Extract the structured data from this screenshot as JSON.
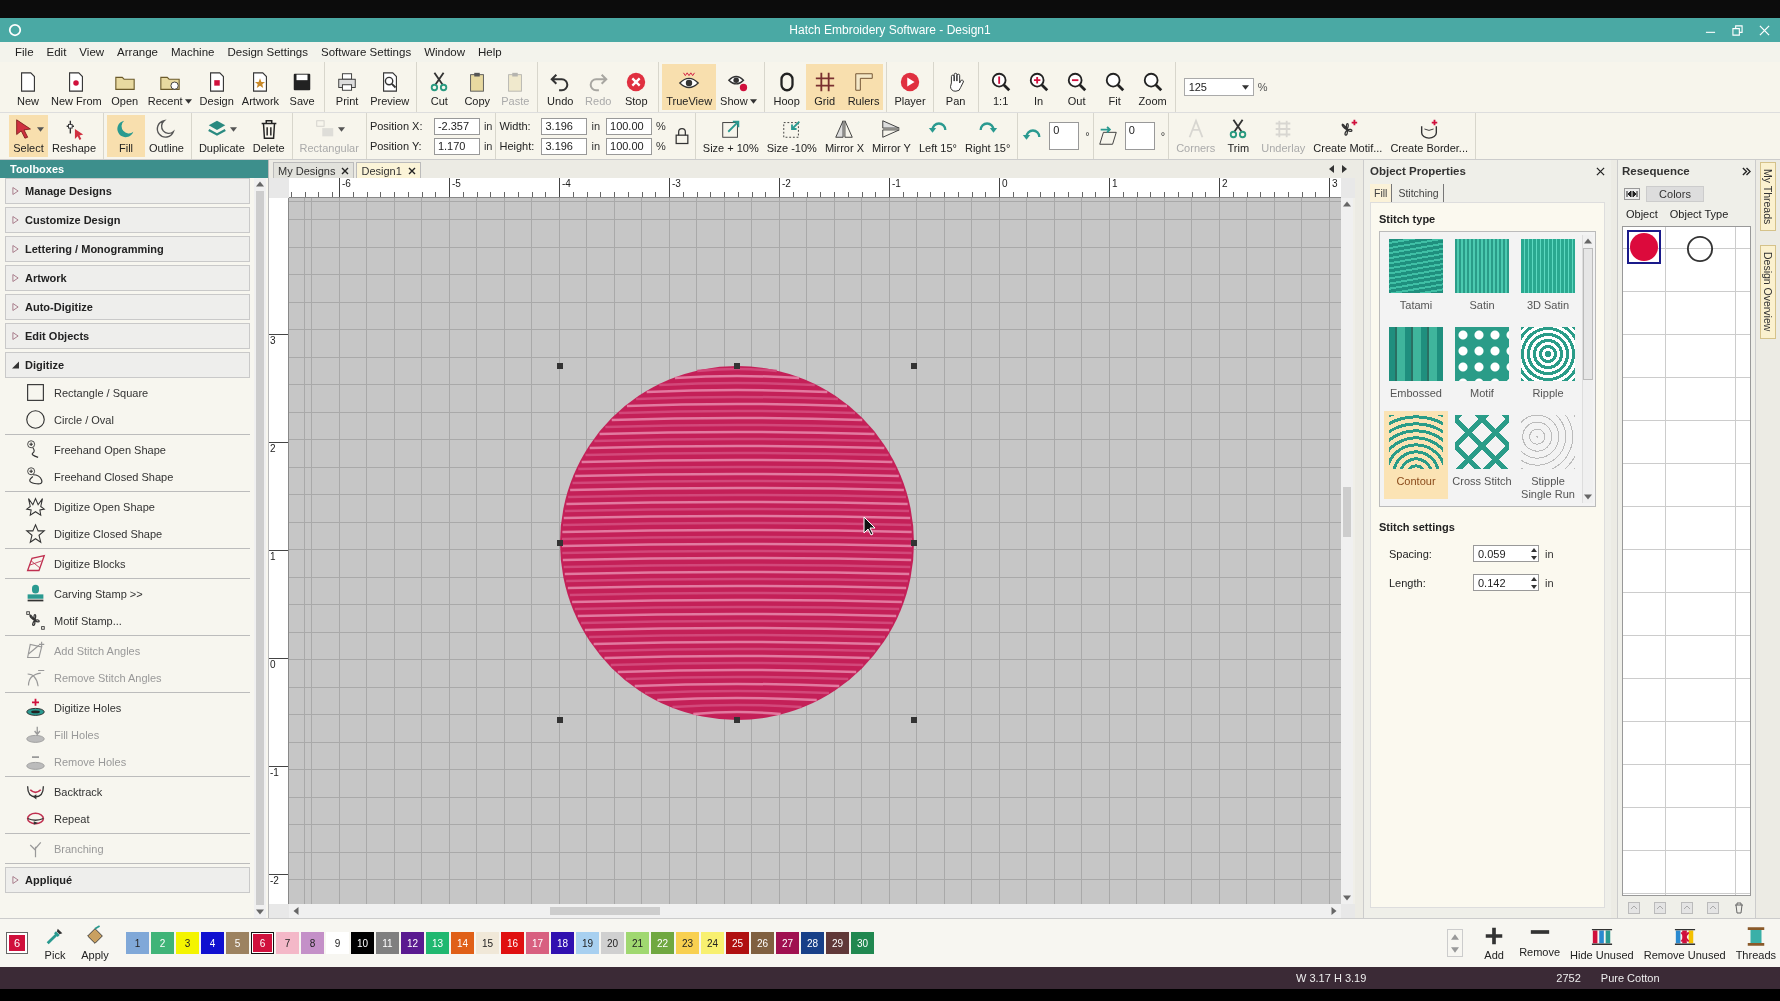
{
  "window": {
    "title": "Hatch Embroidery Software - Design1"
  },
  "menu": [
    "File",
    "Edit",
    "View",
    "Arrange",
    "Machine",
    "Design Settings",
    "Software Settings",
    "Window",
    "Help"
  ],
  "toolbar": {
    "groups": [
      [
        {
          "label": "New",
          "selected": false,
          "disabled": false,
          "caret": false
        },
        {
          "label": "New From",
          "selected": false,
          "disabled": false,
          "caret": false
        },
        {
          "label": "Open",
          "selected": false,
          "disabled": false,
          "caret": false
        },
        {
          "label": "Recent",
          "selected": false,
          "disabled": false,
          "caret": true
        },
        {
          "label": "Design",
          "selected": false,
          "disabled": false,
          "caret": false
        },
        {
          "label": "Artwork",
          "selected": false,
          "disabled": false,
          "caret": false
        },
        {
          "label": "Save",
          "selected": false,
          "disabled": false,
          "caret": false
        }
      ],
      [
        {
          "label": "Print",
          "selected": false,
          "disabled": false,
          "caret": false
        },
        {
          "label": "Preview",
          "selected": false,
          "disabled": false,
          "caret": false
        }
      ],
      [
        {
          "label": "Cut",
          "selected": false,
          "disabled": false,
          "caret": false
        },
        {
          "label": "Copy",
          "selected": false,
          "disabled": false,
          "caret": false
        },
        {
          "label": "Paste",
          "selected": false,
          "disabled": true,
          "caret": false
        }
      ],
      [
        {
          "label": "Undo",
          "selected": false,
          "disabled": false,
          "caret": false
        },
        {
          "label": "Redo",
          "selected": false,
          "disabled": true,
          "caret": false
        },
        {
          "label": "Stop",
          "selected": false,
          "disabled": false,
          "caret": false
        }
      ],
      [
        {
          "label": "TrueView",
          "selected": true,
          "disabled": false,
          "caret": false
        },
        {
          "label": "Show",
          "selected": false,
          "disabled": false,
          "caret": true
        }
      ],
      [
        {
          "label": "Hoop",
          "selected": false,
          "disabled": false,
          "caret": false
        },
        {
          "label": "Grid",
          "selected": true,
          "disabled": false,
          "caret": false
        },
        {
          "label": "Rulers",
          "selected": true,
          "disabled": false,
          "caret": false
        }
      ],
      [
        {
          "label": "Player",
          "selected": false,
          "disabled": false,
          "caret": false
        }
      ],
      [
        {
          "label": "Pan",
          "selected": false,
          "disabled": false,
          "caret": false
        }
      ],
      [
        {
          "label": "1:1",
          "selected": false,
          "disabled": false,
          "caret": false
        },
        {
          "label": "In",
          "selected": false,
          "disabled": false,
          "caret": false
        },
        {
          "label": "Out",
          "selected": false,
          "disabled": false,
          "caret": false
        },
        {
          "label": "Fit",
          "selected": false,
          "disabled": false,
          "caret": false
        },
        {
          "label": "Zoom",
          "selected": false,
          "disabled": false,
          "caret": false
        }
      ]
    ],
    "zoom": {
      "value": "125",
      "unit": "%"
    }
  },
  "edit_bar": {
    "left_groups": [
      [
        {
          "label": "Select",
          "selected": true,
          "disabled": false,
          "caret": true
        },
        {
          "label": "Reshape",
          "selected": false,
          "disabled": false,
          "caret": false
        }
      ],
      [
        {
          "label": "Fill",
          "selected": true,
          "disabled": false,
          "caret": false
        },
        {
          "label": "Outline",
          "selected": false,
          "disabled": false,
          "caret": false
        }
      ],
      [
        {
          "label": "Duplicate",
          "selected": false,
          "disabled": false,
          "caret": true
        },
        {
          "label": "Delete",
          "selected": false,
          "disabled": false,
          "caret": false
        }
      ],
      [
        {
          "label": "Rectangular",
          "selected": false,
          "disabled": true,
          "caret": true
        }
      ]
    ],
    "position": [
      {
        "label": "Position X:",
        "value": "-2.357",
        "unit": "in"
      },
      {
        "label": "Position Y:",
        "value": "1.170",
        "unit": "in"
      }
    ],
    "size": [
      {
        "label": "Width:",
        "value": "3.196",
        "unit": "in"
      },
      {
        "label": "Height:",
        "value": "3.196",
        "unit": "in"
      }
    ],
    "scale": [
      {
        "value": "100.00",
        "unit": "%"
      },
      {
        "value": "100.00",
        "unit": "%"
      }
    ],
    "transform": [
      {
        "label": "Size + 10%",
        "selected": false,
        "disabled": false
      },
      {
        "label": "Size -10%",
        "selected": false,
        "disabled": false
      },
      {
        "label": "Mirror X",
        "selected": false,
        "disabled": false
      },
      {
        "label": "Mirror Y",
        "selected": false,
        "disabled": false
      },
      {
        "label": "Left 15°",
        "selected": false,
        "disabled": false
      },
      {
        "label": "Right 15°",
        "selected": false,
        "disabled": false
      }
    ],
    "rotate": {
      "value": "0",
      "unit": "°"
    },
    "skew": {
      "value": "0",
      "unit": "°"
    },
    "right": [
      {
        "label": "Corners",
        "selected": false,
        "disabled": true
      },
      {
        "label": "Trim",
        "selected": false,
        "disabled": false
      },
      {
        "label": "Underlay",
        "selected": false,
        "disabled": true
      },
      {
        "label": "Create Motif...",
        "selected": false,
        "disabled": false
      },
      {
        "label": "Create Border...",
        "selected": false,
        "disabled": false
      }
    ]
  },
  "toolboxes": {
    "title": "Toolboxes",
    "sections": [
      {
        "title": "Manage Designs",
        "expanded": false
      },
      {
        "title": "Customize Design",
        "expanded": false
      },
      {
        "title": "Lettering / Monogramming",
        "expanded": false
      },
      {
        "title": "Artwork",
        "expanded": false
      },
      {
        "title": "Auto-Digitize",
        "expanded": false
      },
      {
        "title": "Edit Objects",
        "expanded": false
      },
      {
        "title": "Digitize",
        "expanded": true,
        "groups": [
          [
            {
              "label": "Rectangle / Square",
              "disabled": false
            },
            {
              "label": "Circle / Oval",
              "disabled": false
            }
          ],
          [
            {
              "label": "Freehand Open Shape",
              "disabled": false
            },
            {
              "label": "Freehand Closed Shape",
              "disabled": false
            }
          ],
          [
            {
              "label": "Digitize Open Shape",
              "disabled": false
            },
            {
              "label": "Digitize Closed Shape",
              "disabled": false
            }
          ],
          [
            {
              "label": "Digitize Blocks",
              "disabled": false
            }
          ],
          [
            {
              "label": "Carving Stamp >>",
              "disabled": false
            },
            {
              "label": "Motif Stamp...",
              "disabled": false
            }
          ],
          [
            {
              "label": "Add Stitch Angles",
              "disabled": true
            },
            {
              "label": "Remove Stitch Angles",
              "disabled": true
            }
          ],
          [
            {
              "label": "Digitize Holes",
              "disabled": false
            },
            {
              "label": "Fill Holes",
              "disabled": true
            },
            {
              "label": "Remove Holes",
              "disabled": true
            }
          ],
          [
            {
              "label": "Backtrack",
              "disabled": false
            },
            {
              "label": "Repeat",
              "disabled": false
            }
          ],
          [
            {
              "label": "Branching",
              "disabled": true
            }
          ]
        ]
      },
      {
        "title": "Appliqué",
        "expanded": false
      }
    ]
  },
  "document_tabs": [
    {
      "label": "My Designs",
      "selected": false
    },
    {
      "label": "Design1",
      "selected": true
    }
  ],
  "rulers": {
    "horizontal": [
      "-6",
      "-5",
      "-4",
      "-3",
      "-2",
      "-1",
      "0",
      "1",
      "2",
      "3"
    ],
    "vertical": [
      "3",
      "2",
      "1",
      "0",
      "-1",
      "-2"
    ]
  },
  "object_properties": {
    "title": "Object Properties",
    "tabs": [
      {
        "label": "Fill",
        "selected": true
      },
      {
        "label": "Stitching",
        "selected": false
      }
    ],
    "stitch_type": {
      "title": "Stitch type",
      "items": [
        {
          "label": "Tatami",
          "selected": false
        },
        {
          "label": "Satin",
          "selected": false
        },
        {
          "label": "3D Satin",
          "selected": false
        },
        {
          "label": "Embossed",
          "selected": false
        },
        {
          "label": "Motif",
          "selected": false
        },
        {
          "label": "Ripple",
          "selected": false
        },
        {
          "label": "Contour",
          "selected": true
        },
        {
          "label": "Cross Stitch",
          "selected": false
        },
        {
          "label": "Stipple Single Run",
          "selected": false
        }
      ]
    },
    "settings": {
      "title": "Stitch settings",
      "fields": [
        {
          "label": "Spacing:",
          "value": "0.059",
          "unit": "in"
        },
        {
          "label": "Length:",
          "value": "0.142",
          "unit": "in"
        }
      ]
    }
  },
  "resequence": {
    "title": "Resequence",
    "mode_button": "Colors",
    "columns": [
      "Object",
      "Object Type"
    ],
    "rows": [
      {
        "color": "#dc0a3c",
        "selected": true
      }
    ]
  },
  "side_tabs": [
    "My Threads",
    "Design Overview"
  ],
  "palette": {
    "current": {
      "label": "6",
      "color": "#d0103c"
    },
    "tools": [
      "Pick",
      "Apply"
    ],
    "swatches": [
      {
        "label": "1",
        "color": "#80a8d8",
        "selected": false
      },
      {
        "label": "2",
        "color": "#40b478",
        "selected": false
      },
      {
        "label": "3",
        "color": "#f4f400",
        "selected": false
      },
      {
        "label": "4",
        "color": "#1010d0",
        "selected": false
      },
      {
        "label": "5",
        "color": "#9c8260",
        "selected": false
      },
      {
        "label": "6",
        "color": "#d0103c",
        "selected": true
      },
      {
        "label": "7",
        "color": "#f4b8c8",
        "selected": false
      },
      {
        "label": "8",
        "color": "#c490c8",
        "selected": false
      },
      {
        "label": "9",
        "color": "#ffffff",
        "selected": false
      },
      {
        "label": "10",
        "color": "#000000",
        "selected": false
      },
      {
        "label": "11",
        "color": "#7f7f7f",
        "selected": false
      },
      {
        "label": "12",
        "color": "#5a1a90",
        "selected": false
      },
      {
        "label": "13",
        "color": "#20b870",
        "selected": false
      },
      {
        "label": "14",
        "color": "#e06018",
        "selected": false
      },
      {
        "label": "15",
        "color": "#f0e8d8",
        "selected": false
      },
      {
        "label": "16",
        "color": "#e01010",
        "selected": false
      },
      {
        "label": "17",
        "color": "#d86080",
        "selected": false
      },
      {
        "label": "18",
        "color": "#3010b0",
        "selected": false
      },
      {
        "label": "19",
        "color": "#a8d0f0",
        "selected": false
      },
      {
        "label": "20",
        "color": "#d0d0d0",
        "selected": false
      },
      {
        "label": "21",
        "color": "#a0d870",
        "selected": false
      },
      {
        "label": "22",
        "color": "#70a840",
        "selected": false
      },
      {
        "label": "23",
        "color": "#f8d050",
        "selected": false
      },
      {
        "label": "24",
        "color": "#f8f070",
        "selected": false
      },
      {
        "label": "25",
        "color": "#b01010",
        "selected": false
      },
      {
        "label": "26",
        "color": "#806040",
        "selected": false
      },
      {
        "label": "27",
        "color": "#a01050",
        "selected": false
      },
      {
        "label": "28",
        "color": "#184088",
        "selected": false
      },
      {
        "label": "29",
        "color": "#603838",
        "selected": false
      },
      {
        "label": "30",
        "color": "#208850",
        "selected": false
      }
    ]
  },
  "thread_tools": [
    "Add",
    "Remove",
    "Hide Unused",
    "Remove Unused",
    "Threads"
  ],
  "status_bar": {
    "size": "W 3.17 H 3.19",
    "stitch_count": "2752",
    "thread": "Pure Cotton"
  }
}
